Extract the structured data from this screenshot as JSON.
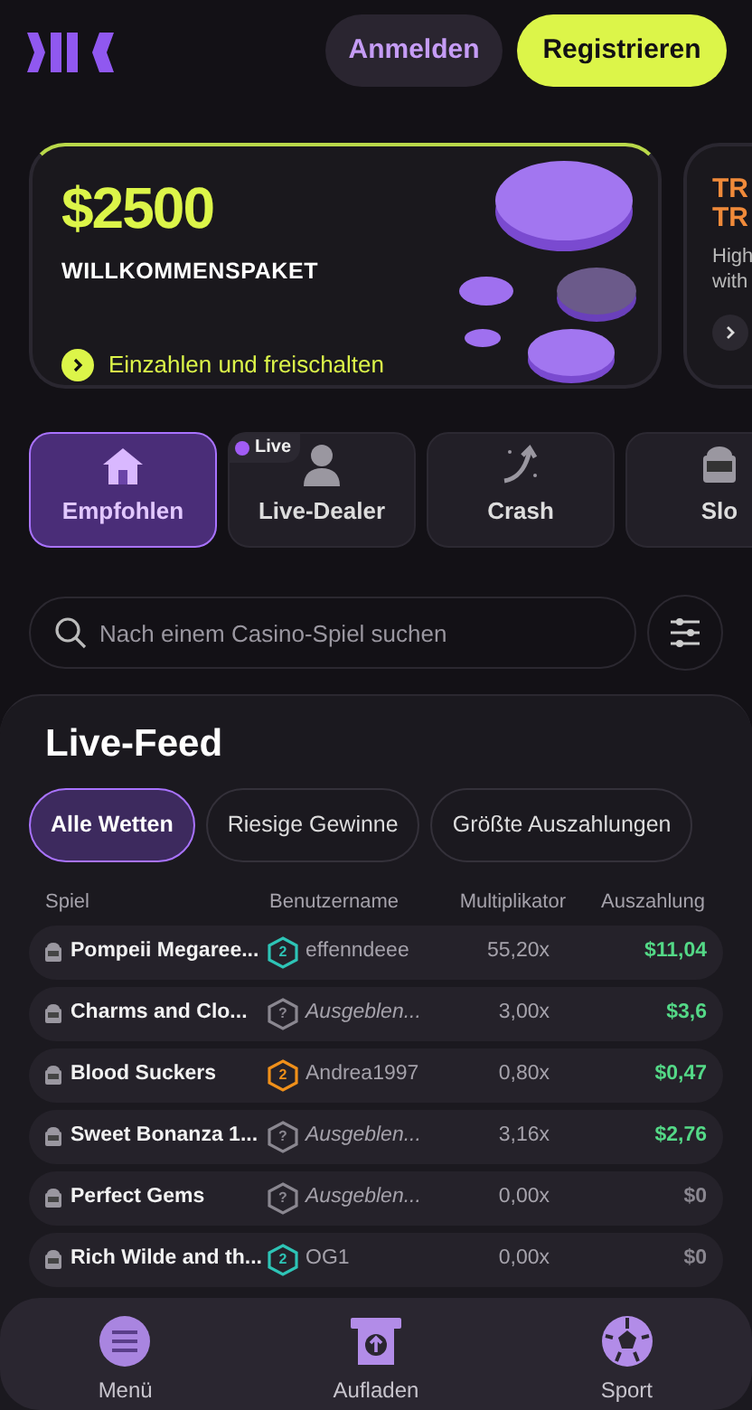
{
  "header": {
    "login": "Anmelden",
    "register": "Registrieren"
  },
  "promos": [
    {
      "amount": "$2500",
      "title": "WILLKOMMENSPAKET",
      "cta": "Einzahlen und freischalten"
    },
    {
      "title_lines": [
        "TR",
        "TR"
      ],
      "text_lines": [
        "High",
        "with"
      ]
    }
  ],
  "categories": [
    {
      "label": "Empfohlen",
      "selected": true,
      "kind": "home"
    },
    {
      "label": "Live-Dealer",
      "selected": false,
      "kind": "dealer",
      "badge": "Live"
    },
    {
      "label": "Crash",
      "selected": false,
      "kind": "crash"
    },
    {
      "label": "Slo",
      "selected": false,
      "kind": "slot"
    }
  ],
  "search": {
    "placeholder": "Nach einem Casino-Spiel suchen"
  },
  "feed": {
    "title": "Live-Feed",
    "tabs": [
      {
        "label": "Alle Wetten",
        "selected": true
      },
      {
        "label": "Riesige Gewinne",
        "selected": false
      },
      {
        "label": "Größte Auszahlungen",
        "selected": false
      }
    ],
    "columns": [
      "Spiel",
      "Benutzername",
      "Multiplikator",
      "Auszahlung"
    ],
    "rows": [
      {
        "game": "Pompeii Megaree...",
        "badge": "2",
        "color": "#2ec4b6",
        "user": "effenndeee",
        "hidden": false,
        "multiplier": "55,20x",
        "payout": "$11,04",
        "win": true
      },
      {
        "game": "Charms and Clo...",
        "badge": "?",
        "color": "#8a8790",
        "user": "Ausgeblen...",
        "hidden": true,
        "multiplier": "3,00x",
        "payout": "$3,6",
        "win": true
      },
      {
        "game": "Blood Suckers",
        "badge": "2",
        "color": "#f0901a",
        "user": "Andrea1997",
        "hidden": false,
        "multiplier": "0,80x",
        "payout": "$0,47",
        "win": true
      },
      {
        "game": "Sweet Bonanza 1...",
        "badge": "?",
        "color": "#8a8790",
        "user": "Ausgeblen...",
        "hidden": true,
        "multiplier": "3,16x",
        "payout": "$2,76",
        "win": true
      },
      {
        "game": "Perfect Gems",
        "badge": "?",
        "color": "#8a8790",
        "user": "Ausgeblen...",
        "hidden": true,
        "multiplier": "0,00x",
        "payout": "$0",
        "win": false
      },
      {
        "game": "Rich Wilde and th...",
        "badge": "2",
        "color": "#2ec4b6",
        "user": "OG1",
        "hidden": false,
        "multiplier": "0,00x",
        "payout": "$0",
        "win": false
      }
    ]
  },
  "bottom_nav": [
    {
      "label": "Menü",
      "kind": "menu"
    },
    {
      "label": "Aufladen",
      "kind": "deposit"
    },
    {
      "label": "Sport",
      "kind": "sport"
    }
  ]
}
